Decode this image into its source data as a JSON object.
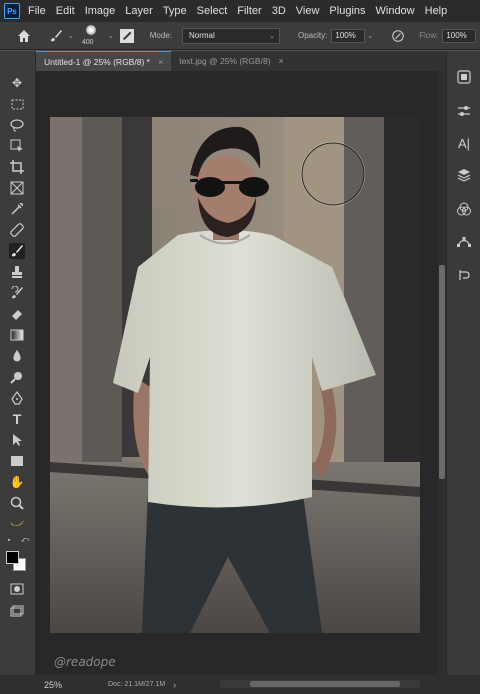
{
  "app": {
    "logo_text": "Ps"
  },
  "menu": [
    "File",
    "Edit",
    "Image",
    "Layer",
    "Type",
    "Select",
    "Filter",
    "3D",
    "View",
    "Plugins",
    "Window",
    "Help"
  ],
  "options": {
    "brush_size": "400",
    "mode_label": "Mode:",
    "mode_value": "Normal",
    "opacity_label": "Opacity:",
    "opacity_value": "100%",
    "flow_label": "Flow:",
    "flow_value": "100%"
  },
  "tabs": [
    {
      "label": "Untitled-1 @ 25% (RGB/8) *",
      "active": true
    },
    {
      "label": "text.jpg @ 25% (RGB/8)",
      "active": false
    }
  ],
  "status": {
    "zoom": "25%",
    "doc_info": "Doc: 21.1M/27.1M"
  },
  "watermark": "@readope",
  "tools": [
    "move-icon",
    "marquee-icon",
    "lasso-icon",
    "object-select-icon",
    "crop-icon",
    "frame-icon",
    "eyedropper-icon",
    "healing-brush-icon",
    "brush-icon",
    "clone-stamp-icon",
    "history-brush-icon",
    "eraser-icon",
    "gradient-icon",
    "blur-icon",
    "dodge-icon",
    "pen-icon",
    "type-icon",
    "path-select-icon",
    "rectangle-icon",
    "hand-icon",
    "zoom-icon",
    "banana-icon"
  ],
  "right_panels": [
    "libraries-icon",
    "adjustments-icon",
    "character-icon",
    "layers-icon",
    "channels-icon",
    "paths-icon",
    "history-icon"
  ],
  "colors": {
    "foreground": "#000000",
    "background": "#ffffff",
    "accent": "#31a8ff"
  }
}
